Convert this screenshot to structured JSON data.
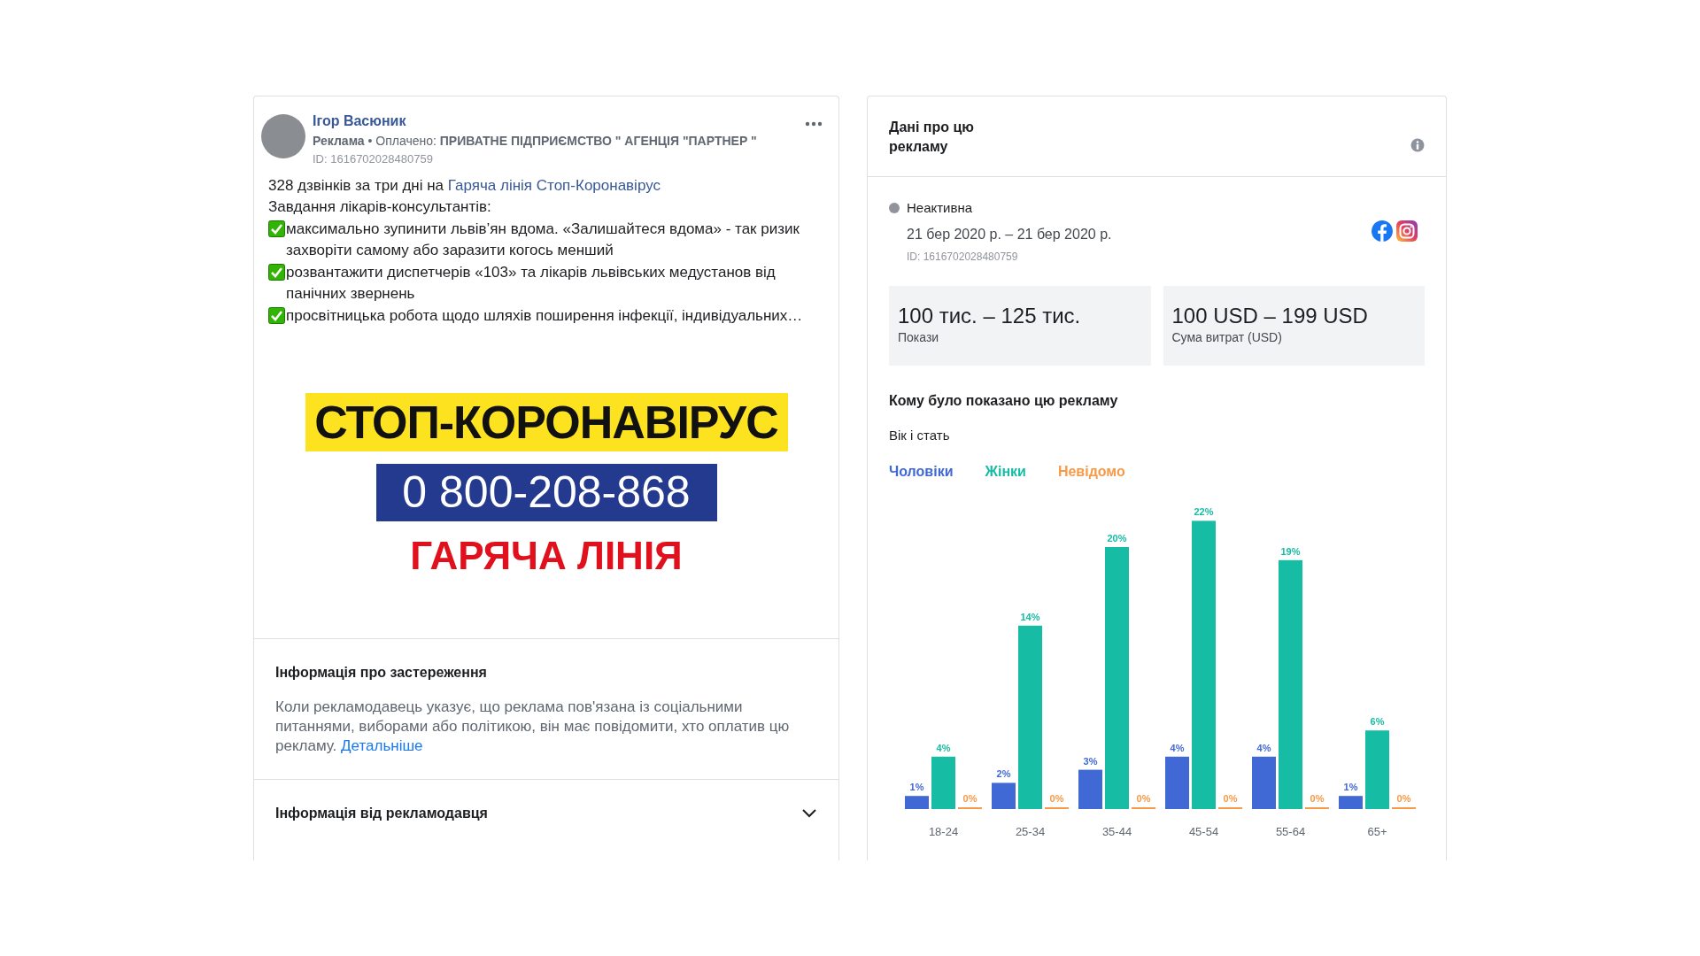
{
  "post": {
    "author": "Ігор Васюник",
    "byline": "**Реклама** • Оплачено: **ПРИВАТНЕ ПІДПРИЄМСТВО \" АГЕНЦІЯ \"ПАРТНЕР \"**",
    "id": "ID: 1616702028480759",
    "intro": "328 дзвінків за три дні на",
    "intro_link": "Гаряча лінія Стоп-Коронавірус",
    "lines": [
      {
        "kind": "text",
        "text": "Завдання лікарів-консультантів:"
      },
      {
        "kind": "check",
        "text": "максимально зупинити львів’ян вдома. «Залишайтеся вдома» - так ризик захворіти самому або заразити когось менший"
      },
      {
        "kind": "check",
        "text": "розвантажити диспетчерів «103» та лікарів львівських медустанов від панічних звернень"
      },
      {
        "kind": "check",
        "text": "просвітницька робота щодо шляхів поширення інфекції, індивідуальних…"
      }
    ],
    "banner": {
      "title": "СТОП-КОРОНАВІРУС",
      "phone": "0 800-208-868",
      "subtitle": "ГАРЯЧА ЛІНІЯ"
    }
  },
  "disclaimer": {
    "title": "Інформація про застереження",
    "text": "Коли рекламодавець указує, що реклама пов'язана із соціальними питаннями, виборами або політикою, він має повідомити, хто оплатив цю рекламу.",
    "link": "Детальніше"
  },
  "advertiser_info": {
    "title": "Інформація від рекламодавця",
    "expanded": false
  },
  "ad_data": {
    "title": "Дані про цю рекламу",
    "status": {
      "label": "Неактивна",
      "active": false
    },
    "dates": "21 бер 2020 р. – 21 бер 2020 р.",
    "id": "ID: 1616702028480759",
    "stats": [
      {
        "value": "100 тис. – 125 тис.",
        "label": "Покази"
      },
      {
        "value": "100 USD – 199 USD",
        "label": "Сума витрат (USD)"
      }
    ]
  },
  "audience": {
    "title": "Кому було показано цю рекламу",
    "subtitle": "Вік і стать",
    "chart_data": {
      "type": "bar",
      "categories": [
        "18-24",
        "25-34",
        "35-44",
        "45-54",
        "55-64",
        "65+"
      ],
      "series": [
        {
          "name": "Чоловіки",
          "color": "#4169d6",
          "values": [
            1,
            2,
            3,
            4,
            4,
            1
          ],
          "value_labels": [
            "1%",
            "2%",
            "3%",
            "4%",
            "4%",
            "1%"
          ]
        },
        {
          "name": "Жінки",
          "color": "#17bca4",
          "values": [
            4,
            14,
            20,
            22,
            19,
            6
          ],
          "value_labels": [
            "4%",
            "14%",
            "20%",
            "22%",
            "19%",
            "6%"
          ]
        },
        {
          "name": "Невідомо",
          "color": "#f79a47",
          "values": [
            0,
            0,
            0,
            0,
            0,
            0
          ],
          "value_labels": [
            "0%",
            "0%",
            "0%",
            "0%",
            "0%",
            "0%"
          ]
        }
      ]
    }
  }
}
